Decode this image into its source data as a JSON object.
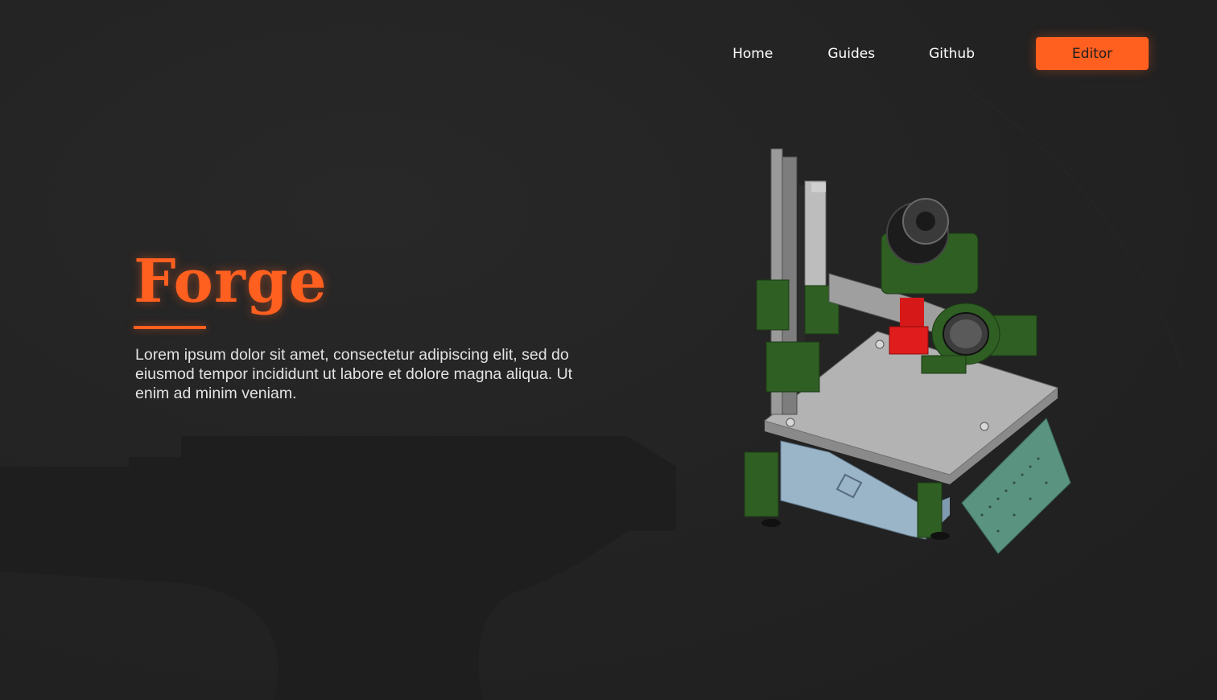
{
  "nav": {
    "home": "Home",
    "guides": "Guides",
    "github": "Github",
    "editor": "Editor"
  },
  "hero": {
    "title": "Forge",
    "description": "Lorem ipsum dolor sit amet, consectetur adipiscing elit, sed do eiusmod tempor incididunt ut labore et dolore magna aliqua. Ut enim ad minim veniam."
  },
  "colors": {
    "accent": "#ff5f1f",
    "background": "#232323",
    "text": "#e3e3e3"
  },
  "icons": {
    "watermark": "anvil-watermark",
    "illustration": "3d-printer-illustration"
  }
}
